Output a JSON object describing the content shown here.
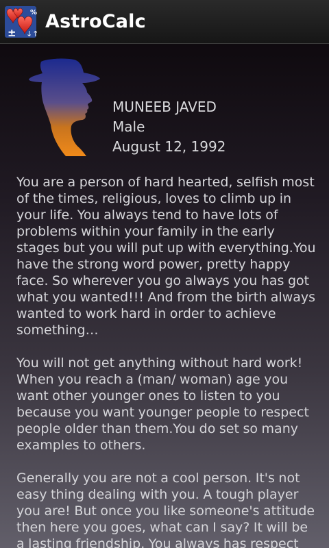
{
  "app": {
    "title": "AstroCalc",
    "icon": "hearts-calculator-icon"
  },
  "profile": {
    "name": "MUNEEB JAVED",
    "gender": "Male",
    "birth_date": "August 12, 1992",
    "avatar": "man-with-hat-silhouette"
  },
  "reading": {
    "paragraphs": [
      "You are a person of hard hearted, selfish most of the times, religious, loves to climb up in your life. You always tend to have lots of problems within your family in the early stages but you will put up with everything.You have the strong word power, pretty happy face. So wherever you go always you has got what you wanted!!! And from the birth always wanted to work hard in order to achieve something…",
      "You will not get anything without hard work! When you reach a (man/ woman) age you want other younger ones to listen to you because you want younger people to respect people older than them.You do set so many examples to others.",
      "Generally you are not a cool person. It's not easy thing dealing with you. A tough player you are! But once you like someone's attitude then here you goes, what can I say? It will be a lasting friendship. You always has respect"
    ]
  },
  "colors": {
    "action_bar": "#1f1f1f",
    "title_text": "#ffffff",
    "body_text": "#d6d6da",
    "silhouette_top": "#1c2a8f",
    "silhouette_bottom": "#f08a1a",
    "heart_red": "#e0231c"
  }
}
